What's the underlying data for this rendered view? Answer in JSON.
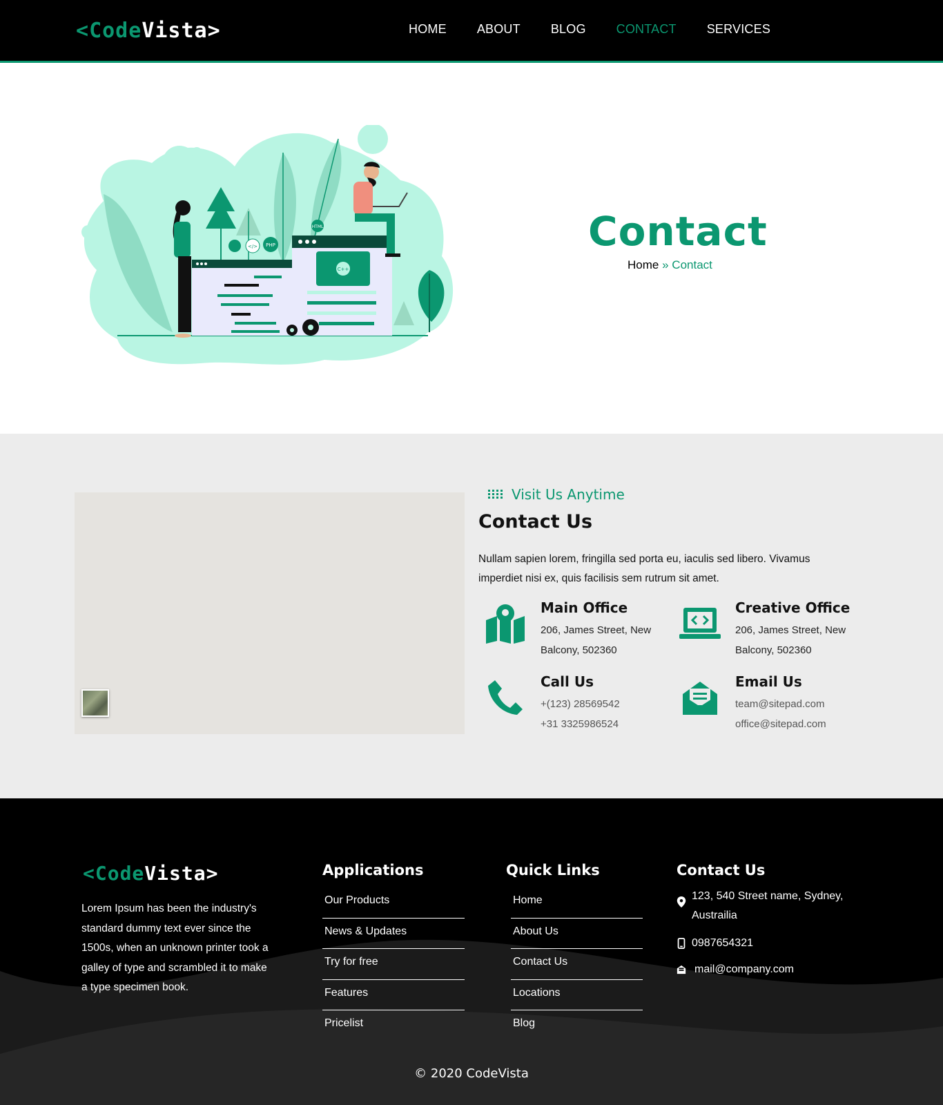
{
  "brand": {
    "logo_left": "<",
    "logo_code": "Code",
    "logo_vista": "Vista",
    "logo_right": ">"
  },
  "nav": [
    {
      "label": "HOME",
      "active": false
    },
    {
      "label": "ABOUT",
      "active": false
    },
    {
      "label": "BLOG",
      "active": false
    },
    {
      "label": "CONTACT",
      "active": true
    },
    {
      "label": "SERVICES",
      "active": false
    }
  ],
  "hero": {
    "title": "Contact",
    "breadcrumb_home": "Home",
    "breadcrumb_sep": "»",
    "breadcrumb_current": "Contact",
    "illustration_tags": [
      "C++",
      "HTML",
      "PHP",
      "</>"
    ]
  },
  "contact": {
    "eyebrow": "Visit Us Anytime",
    "title": "Contact Us",
    "description": "Nullam sapien lorem, fringilla sed porta eu, iaculis sed libero. Vivamus imperdiet nisi ex, quis facilisis sem rutrum sit amet.",
    "cards": [
      {
        "icon": "map-icon",
        "title": "Main Office",
        "line1": "206, James Street, New",
        "line2": "Balcony, 502360"
      },
      {
        "icon": "laptop-code-icon",
        "title": "Creative Office",
        "line1": "206, James Street, New",
        "line2": "Balcony, 502360"
      },
      {
        "icon": "phone-icon",
        "title": "Call Us",
        "line1": "+(123) 28569542",
        "line2": "+31 3325986524"
      },
      {
        "icon": "envelope-open-icon",
        "title": "Email Us",
        "line1": "team@sitepad.com",
        "line2": "office@sitepad.com"
      }
    ]
  },
  "footer": {
    "about": "Lorem Ipsum has been the industry's standard dummy text ever since the 1500s, when an unknown printer took a galley of type and scrambled it to make a type specimen book.",
    "applications": {
      "title": "Applications",
      "items": [
        "Our Products",
        "News & Updates",
        "Try for free",
        "Features",
        "Pricelist"
      ]
    },
    "quick_links": {
      "title": "Quick Links",
      "items": [
        "Home",
        "About Us",
        "Contact Us",
        "Locations",
        "Blog"
      ]
    },
    "contact": {
      "title": "Contact Us",
      "address_line1": "123, 540 Street name, Sydney,",
      "address_line2": "Austrailia",
      "phone": "0987654321",
      "email": "mail@company.com"
    },
    "copyright": "© 2020 CodeVista"
  },
  "colors": {
    "accent": "#0b9770",
    "mint": "#b9f5e3",
    "header_bg": "#000000",
    "section_bg": "#ececec",
    "map_bg": "#e5e3df"
  }
}
